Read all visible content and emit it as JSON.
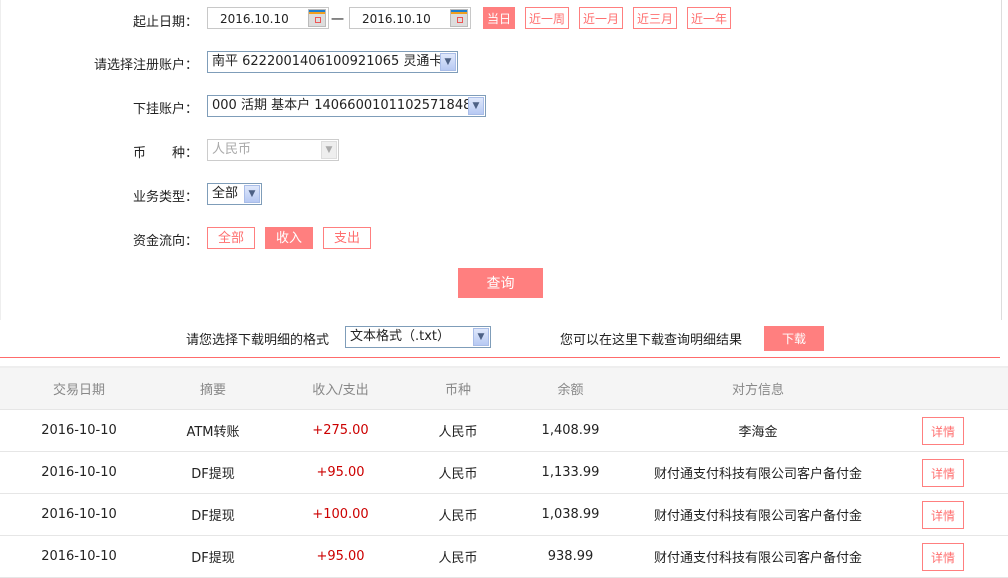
{
  "form": {
    "date_label": "起止日期：",
    "start_date": "2016.10.10",
    "end_date": "2016.10.10",
    "date_sep": "一",
    "periods": [
      "当日",
      "近一周",
      "近一月",
      "近三月",
      "近一年"
    ],
    "account_label": "请选择注册账户：",
    "account_value": "南平 6222001406100921065 灵通卡",
    "sub_account_label": "下挂账户：",
    "sub_account_value": "000 活期 基本户 1406600101102571848",
    "currency_label": "币　　种：",
    "currency_value": "人民币",
    "type_label": "业务类型：",
    "type_value": "全部",
    "flow_label": "资金流向：",
    "flows": [
      "全部",
      "收入",
      "支出"
    ],
    "flow_selected": "收入",
    "query_button": "查询"
  },
  "download": {
    "format_label": "请您选择下载明细的格式",
    "format_value": "文本格式（.txt）",
    "hint": "您可以在这里下载查询明细结果",
    "button": "下载"
  },
  "table": {
    "headers": [
      "交易日期",
      "摘要",
      "收入/支出",
      "币种",
      "余额",
      "对方信息",
      ""
    ],
    "rows": [
      {
        "date": "2016-10-10",
        "summary": "ATM转账",
        "amount": "+275.00",
        "currency": "人民币",
        "balance": "1,408.99",
        "party": "李海金",
        "action": "详情"
      },
      {
        "date": "2016-10-10",
        "summary": "DF提现",
        "amount": "+95.00",
        "currency": "人民币",
        "balance": "1,133.99",
        "party": "财付通支付科技有限公司客户备付金",
        "action": "详情"
      },
      {
        "date": "2016-10-10",
        "summary": "DF提现",
        "amount": "+100.00",
        "currency": "人民币",
        "balance": "1,038.99",
        "party": "财付通支付科技有限公司客户备付金",
        "action": "详情"
      },
      {
        "date": "2016-10-10",
        "summary": "DF提现",
        "amount": "+95.00",
        "currency": "人民币",
        "balance": "938.99",
        "party": "财付通支付科技有限公司客户备付金",
        "action": "详情"
      }
    ]
  },
  "colors": {
    "accent": "#ff7f7f",
    "income": "#cc0000"
  }
}
